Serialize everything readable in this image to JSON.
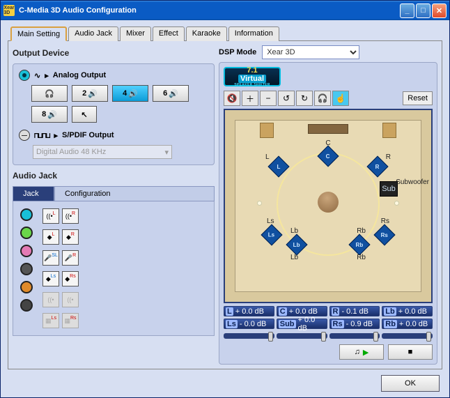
{
  "window": {
    "title": "C-Media 3D Audio Configuration"
  },
  "tabs": [
    "Main Setting",
    "Audio Jack",
    "Mixer",
    "Effect",
    "Karaoke",
    "Information"
  ],
  "activeTab": 0,
  "output": {
    "heading": "Output Device",
    "analog": {
      "label": "Analog Output"
    },
    "speakerBtns": {
      "two": "2",
      "four": "4",
      "six": "6",
      "eight": "8"
    },
    "spdif": {
      "label": "S/PDIF Output",
      "selected": "Digital Audio 48 KHz"
    }
  },
  "audioJack": {
    "heading": "Audio Jack",
    "tabs": {
      "jack": "Jack",
      "config": "Configuration"
    },
    "jackColors": [
      "#19c0d8",
      "#6ad64a",
      "#e47ab4",
      "#555555",
      "#e08a2a",
      "#444444"
    ]
  },
  "dsp": {
    "label": "DSP Mode",
    "selected": "Xear 3D",
    "badge": {
      "top": "7.1",
      "mid": "Virtual",
      "bot": "SPEAKER SHIFTER"
    },
    "reset": "Reset"
  },
  "room": {
    "labels": {
      "C": "C",
      "L": "L",
      "R": "R",
      "Ls": "Ls",
      "Rs": "Rs",
      "Lb": "Lb",
      "Rb": "Rb",
      "Sub": "Sub",
      "Subwoofer": "Subwoofer"
    }
  },
  "levels": [
    {
      "ch": "L",
      "val": "+ 0.0 dB"
    },
    {
      "ch": "C",
      "val": "+ 0.0 dB"
    },
    {
      "ch": "R",
      "val": "- 0.1 dB"
    },
    {
      "ch": "Lb",
      "val": "+ 0.0 dB"
    },
    {
      "ch": "Ls",
      "val": "- 0.0 dB"
    },
    {
      "ch": "Sub",
      "val": "+ 0.0 dB"
    },
    {
      "ch": "Rs",
      "val": "- 0.9 dB"
    },
    {
      "ch": "Rb",
      "val": "+ 0.0 dB"
    }
  ],
  "footer": {
    "ok": "OK"
  }
}
